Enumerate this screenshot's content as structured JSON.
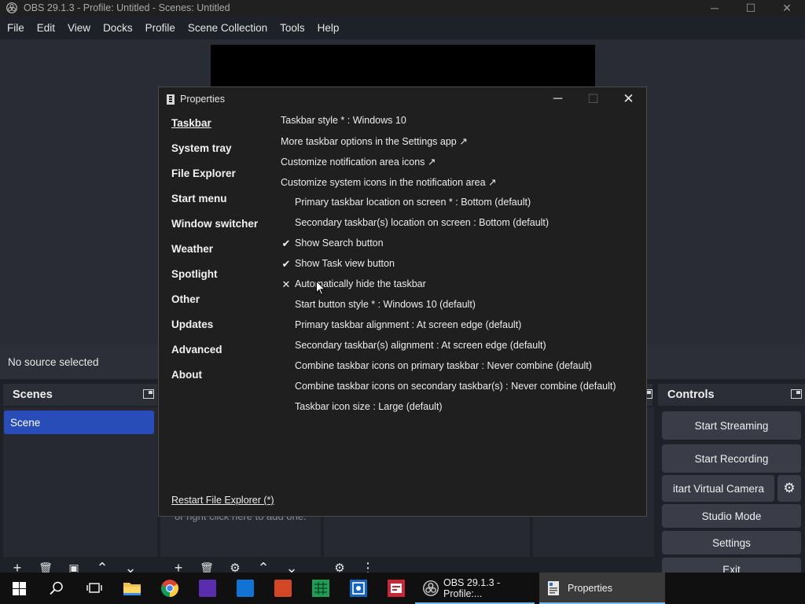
{
  "window": {
    "title": "OBS 29.1.3 - Profile: Untitled - Scenes: Untitled",
    "minimize": "─",
    "maximize": "☐",
    "close": "✕"
  },
  "menu": [
    "File",
    "Edit",
    "View",
    "Docks",
    "Profile",
    "Scene Collection",
    "Tools",
    "Help"
  ],
  "source_status": "No source selected",
  "scenes": {
    "title": "Scenes",
    "items": [
      "Scene"
    ]
  },
  "sources_hint": "or right click here to add one.",
  "controls": {
    "title": "Controls",
    "start_streaming": "Start Streaming",
    "start_recording": "Start Recording",
    "start_virtual_camera": "itart Virtual Camera",
    "studio_mode": "Studio Mode",
    "settings": "Settings",
    "exit": "Exit"
  },
  "dock_toolbar": {
    "add": "+",
    "remove": "🗑",
    "filter": "▣",
    "up": "⌃",
    "down": "⌄",
    "gear": "⚙",
    "more": "⋮"
  },
  "properties": {
    "title": "Properties",
    "nav": [
      "Taskbar",
      "System tray",
      "File Explorer",
      "Start menu",
      "Window switcher",
      "Weather",
      "Spotlight",
      "Other",
      "Updates",
      "Advanced",
      "About"
    ],
    "options": [
      {
        "text": "Taskbar style * : Windows 10",
        "indent": false,
        "mark": ""
      },
      {
        "text": "More taskbar options in the Settings app ↗",
        "indent": false,
        "mark": ""
      },
      {
        "text": "Customize notification area icons ↗",
        "indent": false,
        "mark": ""
      },
      {
        "text": "Customize system icons in the notification area ↗",
        "indent": false,
        "mark": ""
      },
      {
        "text": "Primary taskbar location on screen * : Bottom (default)",
        "indent": true,
        "mark": ""
      },
      {
        "text": "Secondary taskbar(s) location on screen : Bottom (default)",
        "indent": true,
        "mark": ""
      },
      {
        "text": "Show Search button",
        "indent": true,
        "mark": "✔"
      },
      {
        "text": "Show Task view button",
        "indent": true,
        "mark": "✔"
      },
      {
        "text": "Automatically hide the taskbar",
        "indent": true,
        "mark": "✕"
      },
      {
        "text": "Start button style * : Windows 10 (default)",
        "indent": true,
        "mark": ""
      },
      {
        "text": "Primary taskbar alignment : At screen edge (default)",
        "indent": true,
        "mark": ""
      },
      {
        "text": "Secondary taskbar(s) alignment : At screen edge (default)",
        "indent": true,
        "mark": ""
      },
      {
        "text": "Combine taskbar icons on primary taskbar : Never combine (default)",
        "indent": true,
        "mark": ""
      },
      {
        "text": "Combine taskbar icons on secondary taskbar(s) : Never combine (default)",
        "indent": true,
        "mark": ""
      },
      {
        "text": "Taskbar icon size : Large (default)",
        "indent": true,
        "mark": ""
      }
    ],
    "footer": "Restart File Explorer (*)"
  },
  "taskbar": {
    "apps": [
      {
        "label": "OBS 29.1.3 - Profile:...",
        "active": false
      },
      {
        "label": "Properties",
        "active": true
      }
    ],
    "icons": [
      "search-icon",
      "task-view-icon",
      "file-explorer-icon",
      "chrome-icon",
      "purple-app-icon",
      "blue-app-icon",
      "powerpoint-icon",
      "excel-icon",
      "blue-app-2-icon",
      "red-app-icon"
    ]
  }
}
